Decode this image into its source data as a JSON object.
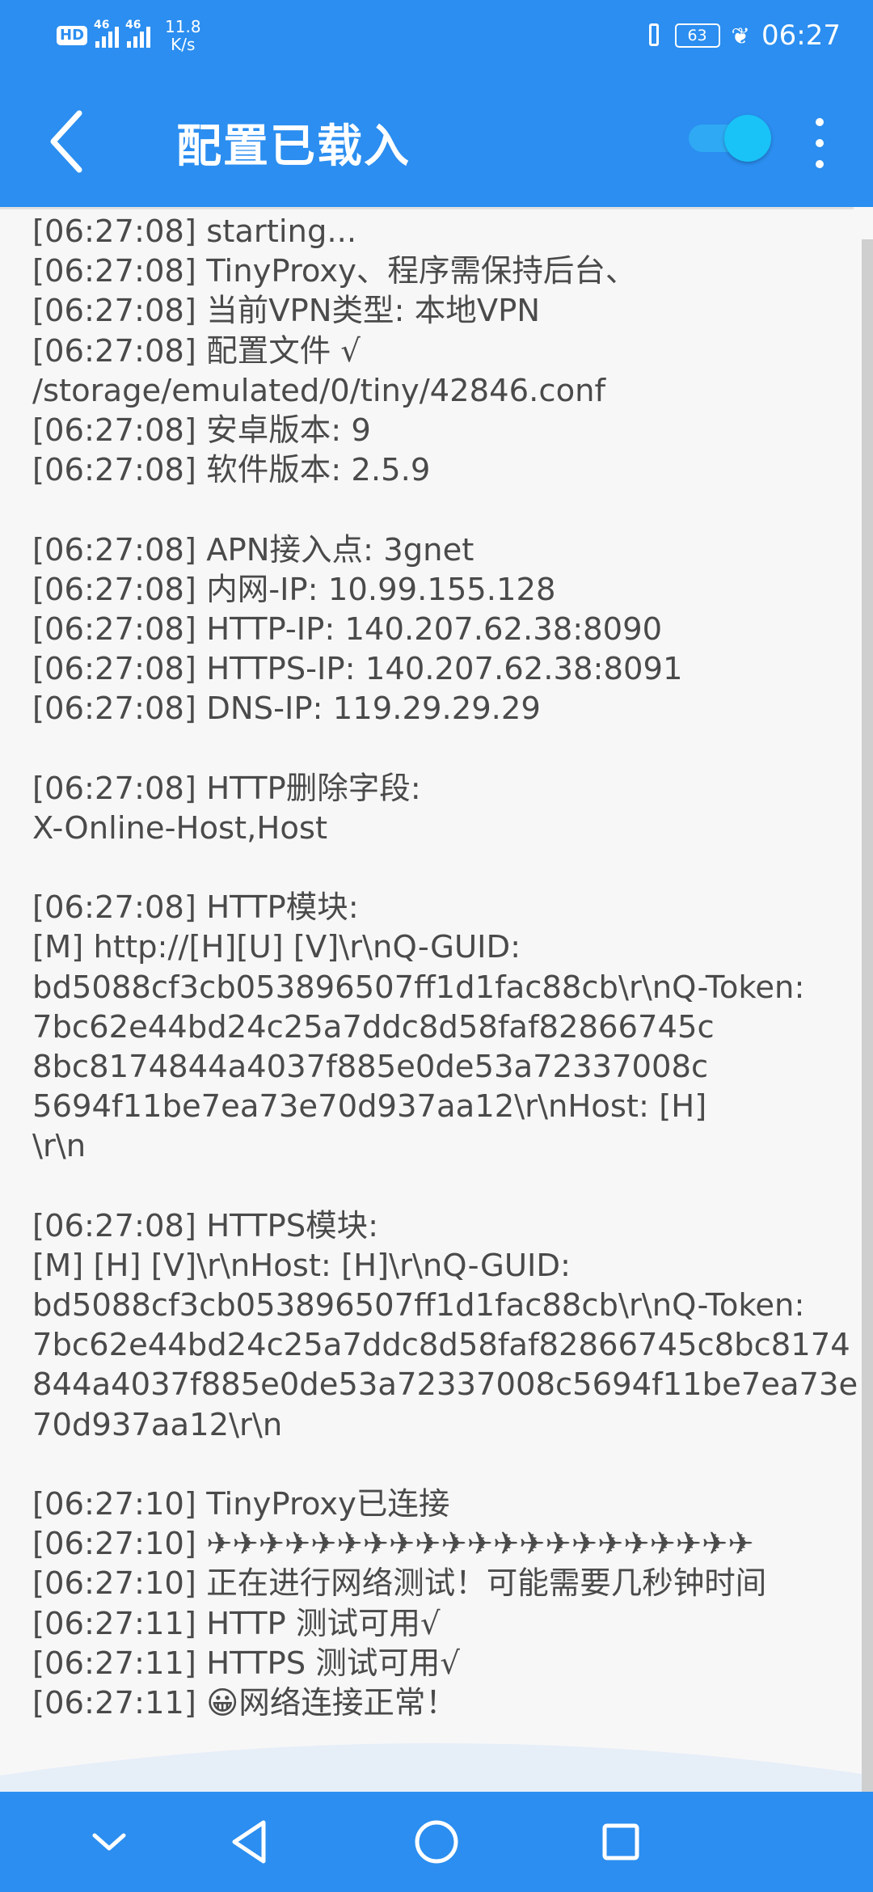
{
  "status_bar": {
    "hd": "HD",
    "sim1": "46",
    "sim2": "46",
    "speed_value": "11.8",
    "speed_unit": "K/s",
    "battery": "63",
    "time": "06:27"
  },
  "toolbar": {
    "title": "配置已载入",
    "toggle_on": true
  },
  "log_lines": [
    "[06:27:08] starting...",
    "[06:27:08] TinyProxy、程序需保持后台、",
    "[06:27:08] 当前VPN类型: 本地VPN",
    "[06:27:08] 配置文件 √",
    "/storage/emulated/0/tiny/42846.conf",
    "[06:27:08] 安卓版本: 9",
    "[06:27:08] 软件版本: 2.5.9",
    "",
    "[06:27:08] APN接入点: 3gnet",
    "[06:27:08] 内网-IP: 10.99.155.128",
    "[06:27:08] HTTP-IP: 140.207.62.38:8090",
    "[06:27:08] HTTPS-IP: 140.207.62.38:8091",
    "[06:27:08] DNS-IP: 119.29.29.29",
    "",
    "[06:27:08] HTTP删除字段:",
    "X-Online-Host,Host",
    "",
    "[06:27:08] HTTP模块:",
    "[M] http://[H][U] [V]\\r\\nQ-GUID:",
    "bd5088cf3cb053896507ff1d1fac88cb\\r\\nQ-Token:",
    "7bc62e44bd24c25a7ddc8d58faf82866745c",
    "8bc8174844a4037f885e0de53a72337008c",
    "5694f11be7ea73e70d937aa12\\r\\nHost: [H]",
    "\\r\\n",
    "",
    "[06:27:08] HTTPS模块:",
    "[M] [H] [V]\\r\\nHost: [H]\\r\\nQ-GUID:",
    "bd5088cf3cb053896507ff1d1fac88cb\\r\\nQ-Token:",
    "7bc62e44bd24c25a7ddc8d58faf82866745c8bc8174",
    "844a4037f885e0de53a72337008c5694f11be7ea73e",
    "70d937aa12\\r\\n",
    "",
    "[06:27:10] TinyProxy已连接",
    "[06:27:10] ✈✈✈✈✈✈✈✈✈✈✈✈✈✈✈✈✈✈✈✈✈",
    "[06:27:10] 正在进行网络测试！可能需要几秒钟时间",
    "[06:27:11] HTTP 测试可用√",
    "[06:27:11] HTTPS 测试可用√",
    "[06:27:11] 😀网络连接正常！"
  ],
  "icons": {
    "back": "back-arrow-icon",
    "more": "more-vert-icon",
    "nav_down": "chevron-down-icon",
    "nav_back": "triangle-back-icon",
    "nav_home": "circle-home-icon",
    "nav_recent": "square-recent-icon"
  },
  "colors": {
    "primary": "#2b8ef0",
    "toggle": "#19c2f7",
    "log_text": "#4a4a4a",
    "background": "#f7f7f7"
  }
}
